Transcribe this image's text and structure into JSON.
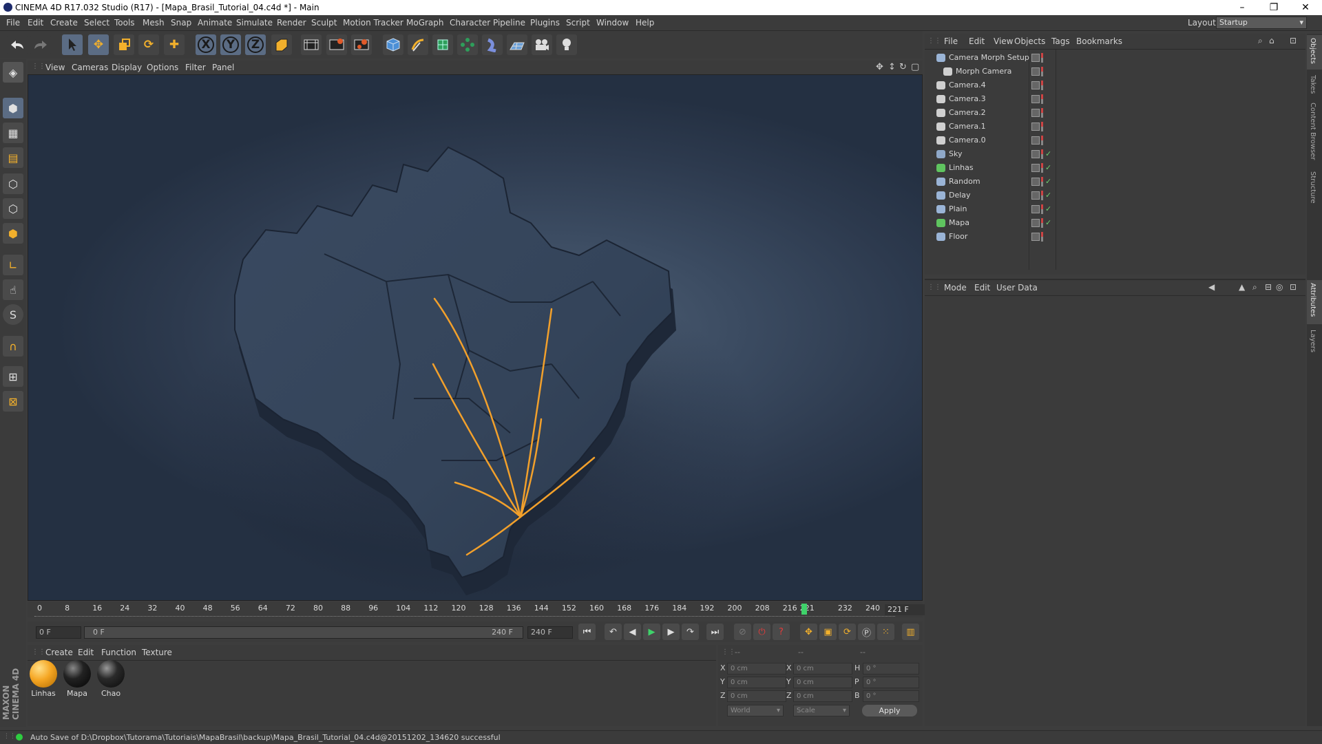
{
  "window": {
    "title": "CINEMA 4D R17.032 Studio (R17) - [Mapa_Brasil_Tutorial_04.c4d *] - Main",
    "controls": [
      "–",
      "❐",
      "✕"
    ]
  },
  "menubar": [
    "File",
    "Edit",
    "Create",
    "Select",
    "Tools",
    "Mesh",
    "Snap",
    "Animate",
    "Simulate",
    "Render",
    "Sculpt",
    "Motion Tracker",
    "MoGraph",
    "Character",
    "Pipeline",
    "Plugins",
    "Script",
    "Window",
    "Help"
  ],
  "layout": {
    "label": "Layout:",
    "value": "Startup"
  },
  "toolbar_icons": [
    "undo-icon",
    "redo-icon",
    "select-arrow-icon",
    "move-icon",
    "scale-icon",
    "rotate-icon",
    "add-icon",
    "x-axis-icon",
    "y-axis-icon",
    "z-axis-icon",
    "world-coord-icon",
    "render-view-icon",
    "render-picture-viewer-icon",
    "edit-render-settings-icon",
    "cube-icon",
    "pen-spline-icon",
    "subdivision-icon",
    "array-icon",
    "deformer-icon",
    "floor-icon",
    "camera-icon",
    "light-icon"
  ],
  "toolbar_glyphs": {
    "x": "X",
    "y": "Y",
    "z": "Z"
  },
  "left_tools": [
    "make-editable-icon",
    "model-mode-icon",
    "texture-mode-icon",
    "workplane-icon",
    "points-mode-icon",
    "edges-mode-icon",
    "polygons-mode-icon",
    "axis-icon",
    "tweak-icon",
    "snap-icon",
    "magnet-icon",
    "lock-workplane-icon",
    "enable-grid-icon"
  ],
  "viewport": {
    "menu": [
      "View",
      "Cameras",
      "Display",
      "Options",
      "Filter",
      "Panel"
    ]
  },
  "timeline": {
    "ticks": [
      "0",
      "8",
      "16",
      "24",
      "32",
      "40",
      "48",
      "56",
      "64",
      "72",
      "80",
      "88",
      "96",
      "104",
      "112",
      "120",
      "128",
      "136",
      "144",
      "152",
      "160",
      "168",
      "176",
      "184",
      "192",
      "200",
      "208",
      "216",
      "221",
      "232",
      "240"
    ],
    "current_frame": 221,
    "max_frame": 240,
    "current_field": "221 F",
    "start_field": "0 F",
    "slider_start": "0 F",
    "slider_end": "240 F",
    "end_field": "240 F"
  },
  "material_manager": {
    "menu": [
      "Create",
      "Edit",
      "Function",
      "Texture"
    ],
    "materials": [
      {
        "name": "Linhas",
        "color": "#f5a623"
      },
      {
        "name": "Mapa",
        "color": "#111111"
      },
      {
        "name": "Chao",
        "color": "#1a1a1a"
      }
    ]
  },
  "coordinates": {
    "header": [
      "--",
      "--",
      "--"
    ],
    "rows": [
      {
        "a": "X",
        "av": "0 cm",
        "b": "X",
        "bv": "0 cm",
        "c": "H",
        "cv": "0 °"
      },
      {
        "a": "Y",
        "av": "0 cm",
        "b": "Y",
        "bv": "0 cm",
        "c": "P",
        "cv": "0 °"
      },
      {
        "a": "Z",
        "av": "0 cm",
        "b": "Z",
        "bv": "0 cm",
        "c": "B",
        "cv": "0 °"
      }
    ],
    "mode1": "World",
    "mode2": "Scale",
    "apply": "Apply"
  },
  "object_manager": {
    "menu": [
      "File",
      "Edit",
      "View",
      "Objects",
      "Tags",
      "Bookmarks"
    ],
    "objects": [
      {
        "name": "Camera Morph Setup",
        "icon": "null-icon",
        "color": "#9ab4d6",
        "check": ""
      },
      {
        "name": "Morph Camera",
        "icon": "camera-icon",
        "color": "#cfcfcf",
        "check": ""
      },
      {
        "name": "Camera.4",
        "icon": "camera-icon",
        "color": "#cfcfcf",
        "check": ""
      },
      {
        "name": "Camera.3",
        "icon": "camera-icon",
        "color": "#cfcfcf",
        "check": ""
      },
      {
        "name": "Camera.2",
        "icon": "camera-icon",
        "color": "#cfcfcf",
        "check": ""
      },
      {
        "name": "Camera.1",
        "icon": "camera-icon",
        "color": "#cfcfcf",
        "check": ""
      },
      {
        "name": "Camera.0",
        "icon": "camera-icon",
        "color": "#cfcfcf",
        "check": ""
      },
      {
        "name": "Sky",
        "icon": "sky-icon",
        "color": "#8fa8c8",
        "check": "✓"
      },
      {
        "name": "Linhas",
        "icon": "tracer-icon",
        "color": "#5fc45f",
        "check": "✓"
      },
      {
        "name": "Random",
        "icon": "random-effector-icon",
        "color": "#9ab4d6",
        "check": "✓"
      },
      {
        "name": "Delay",
        "icon": "delay-effector-icon",
        "color": "#9ab4d6",
        "check": "✓"
      },
      {
        "name": "Plain",
        "icon": "plain-effector-icon",
        "color": "#9ab4d6",
        "check": "✓"
      },
      {
        "name": "Mapa",
        "icon": "fracture-icon",
        "color": "#5fc45f",
        "check": "✓"
      },
      {
        "name": "Floor",
        "icon": "floor-icon",
        "color": "#9ab4d6",
        "check": ""
      }
    ]
  },
  "attribute_manager": {
    "menu": [
      "Mode",
      "Edit",
      "User Data"
    ]
  },
  "side_tabs": [
    "Objects",
    "Takes",
    "Content Browser",
    "Structure",
    "Attributes",
    "Layers"
  ],
  "branding": {
    "line1": "MAXON",
    "line2": "CINEMA 4D"
  },
  "status": {
    "text": "Auto Save of D:\\Dropbox\\Tutorama\\Tutoriais\\MapaBrasil\\backup\\Mapa_Brasil_Tutorial_04.c4d@20151202_134620 successful",
    "indicator": "#2ecc40"
  }
}
